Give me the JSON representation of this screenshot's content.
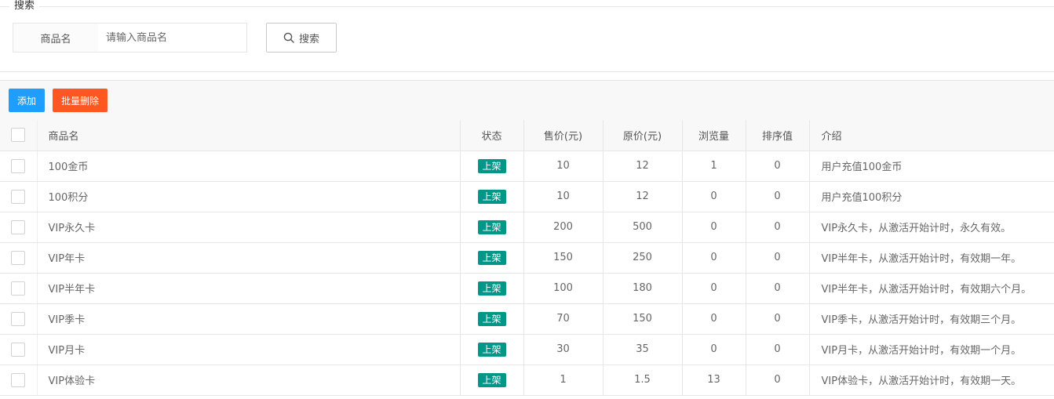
{
  "search": {
    "legend": "搜索",
    "field_label": "商品名",
    "placeholder": "请输入商品名",
    "value": "",
    "button_label": "搜索"
  },
  "toolbar": {
    "add_label": "添加",
    "batch_delete_label": "批量删除",
    "add_color": "#1e9fff",
    "batch_delete_color": "#ff5722"
  },
  "table": {
    "columns": [
      "商品名",
      "状态",
      "售价(元)",
      "原价(元)",
      "浏览量",
      "排序值",
      "介绍"
    ],
    "status_color": "#009688",
    "rows": [
      {
        "name": "100金币",
        "status": "上架",
        "sale_price": "10",
        "original_price": "12",
        "views": "1",
        "sort": "0",
        "intro": "用户充值100金币"
      },
      {
        "name": "100积分",
        "status": "上架",
        "sale_price": "10",
        "original_price": "12",
        "views": "0",
        "sort": "0",
        "intro": "用户充值100积分"
      },
      {
        "name": "VIP永久卡",
        "status": "上架",
        "sale_price": "200",
        "original_price": "500",
        "views": "0",
        "sort": "0",
        "intro": "VIP永久卡，从激活开始计时，永久有效。"
      },
      {
        "name": "VIP年卡",
        "status": "上架",
        "sale_price": "150",
        "original_price": "250",
        "views": "0",
        "sort": "0",
        "intro": "VIP半年卡，从激活开始计时，有效期一年。"
      },
      {
        "name": "VIP半年卡",
        "status": "上架",
        "sale_price": "100",
        "original_price": "180",
        "views": "0",
        "sort": "0",
        "intro": "VIP半年卡，从激活开始计时，有效期六个月。"
      },
      {
        "name": "VIP季卡",
        "status": "上架",
        "sale_price": "70",
        "original_price": "150",
        "views": "0",
        "sort": "0",
        "intro": "VIP季卡，从激活开始计时，有效期三个月。"
      },
      {
        "name": "VIP月卡",
        "status": "上架",
        "sale_price": "30",
        "original_price": "35",
        "views": "0",
        "sort": "0",
        "intro": "VIP月卡，从激活开始计时，有效期一个月。"
      },
      {
        "name": "VIP体验卡",
        "status": "上架",
        "sale_price": "1",
        "original_price": "1.5",
        "views": "13",
        "sort": "0",
        "intro": "VIP体验卡，从激活开始计时，有效期一天。"
      }
    ]
  }
}
